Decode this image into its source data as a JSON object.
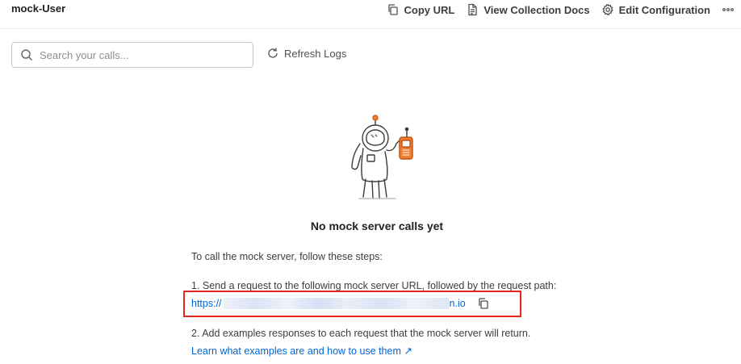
{
  "header": {
    "title": "mock-User",
    "copy_url_label": "Copy URL",
    "view_docs_label": "View Collection Docs",
    "edit_config_label": "Edit Configuration"
  },
  "search": {
    "placeholder": "Search your calls..."
  },
  "refresh_label": "Refresh Logs",
  "empty_state": {
    "title": "No mock server calls yet",
    "intro": "To call the mock server, follow these steps:",
    "step1": "1. Send a request to the following mock server URL, followed by the request path:",
    "url_prefix": "https://",
    "url_suffix": "n.io",
    "step2": "2. Add examples responses to each request that the mock server will return.",
    "learn_link": "Learn what examples are and how to use them ↗"
  },
  "colors": {
    "link": "#0265d2",
    "highlight": "#e3261f",
    "accent": "#f07c2e"
  }
}
